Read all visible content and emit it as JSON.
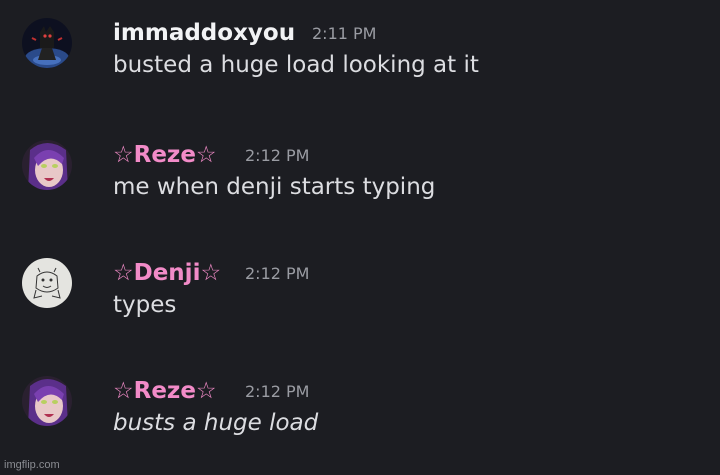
{
  "messages": [
    {
      "username": "immaddoxyou",
      "username_color": "#f2f3f5",
      "timestamp": "2:11 PM",
      "content": "busted a huge load looking at it",
      "italic": false,
      "avatar_icon": "dark-character-avatar"
    },
    {
      "username": "☆Reze☆",
      "username_color": "#f28bc8",
      "timestamp": "2:12 PM",
      "content": "me when denji starts typing",
      "italic": false,
      "avatar_icon": "purple-hair-anime-avatar"
    },
    {
      "username": "☆Denji☆",
      "username_color": "#f28bc8",
      "timestamp": "2:12 PM",
      "content": "types",
      "italic": false,
      "avatar_icon": "sketch-avatar"
    },
    {
      "username": "☆Reze☆",
      "username_color": "#f28bc8",
      "timestamp": "2:12 PM",
      "content": "busts a huge load",
      "italic": true,
      "avatar_icon": "purple-hair-anime-avatar"
    }
  ],
  "watermark": "imgflip.com"
}
